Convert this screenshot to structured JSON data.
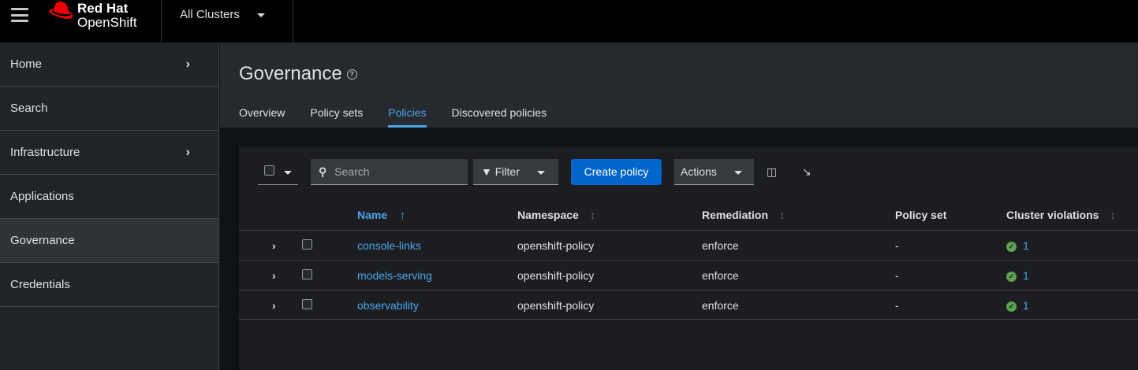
{
  "topbar": {
    "brand_line1": "Red Hat",
    "brand_line2": "OpenShift",
    "cluster_selector": "All Clusters"
  },
  "sidebar": {
    "items": [
      {
        "label": "Home",
        "expandable": true
      },
      {
        "label": "Search"
      },
      {
        "label": "Infrastructure",
        "expandable": true
      },
      {
        "label": "Applications"
      },
      {
        "label": "Governance",
        "active": true
      },
      {
        "label": "Credentials"
      }
    ]
  },
  "page": {
    "title": "Governance",
    "tabs": [
      "Overview",
      "Policy sets",
      "Policies",
      "Discovered policies"
    ],
    "active_tab": "Policies"
  },
  "toolbar": {
    "search_placeholder": "Search",
    "filter_label": "Filter",
    "create_label": "Create policy",
    "actions_label": "Actions"
  },
  "table": {
    "columns": [
      "Name",
      "Namespace",
      "Remediation",
      "Policy set",
      "Cluster violations"
    ],
    "rows": [
      {
        "name": "console-links",
        "namespace": "openshift-policy",
        "remediation": "enforce",
        "policy_set": "-",
        "violations": "1"
      },
      {
        "name": "models-serving",
        "namespace": "openshift-policy",
        "remediation": "enforce",
        "policy_set": "-",
        "violations": "1"
      },
      {
        "name": "observability",
        "namespace": "openshift-policy",
        "remediation": "enforce",
        "policy_set": "-",
        "violations": "1"
      }
    ]
  },
  "colors": {
    "accent": "#4aa7ea",
    "primary_button": "#0066cc",
    "success": "#5ba352",
    "logo_red": "#ee0000"
  }
}
